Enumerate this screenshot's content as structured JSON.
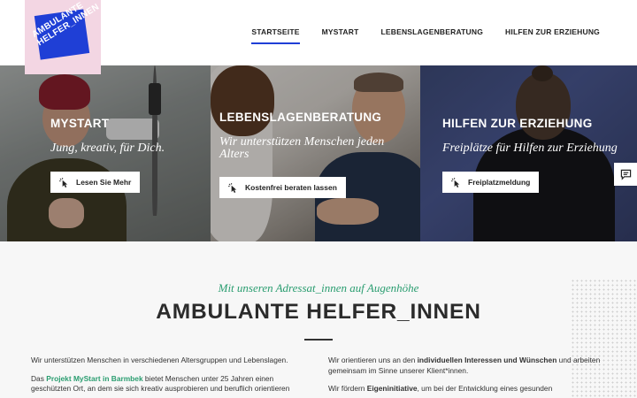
{
  "logo": {
    "line1": "AMBULANTE",
    "line2": "HELFER_INNEN"
  },
  "nav": {
    "items": [
      {
        "label": "STARTSEITE",
        "active": true
      },
      {
        "label": "MYSTART",
        "active": false
      },
      {
        "label": "LEBENSLAGENBERATUNG",
        "active": false
      },
      {
        "label": "HILFEN ZUR ERZIEHUNG",
        "active": false
      }
    ]
  },
  "hero": {
    "panels": [
      {
        "title": "MYSTART",
        "subtitle": "Jung, kreativ, für Dich.",
        "button": "Lesen Sie Mehr"
      },
      {
        "title": "LEBENSLAGENBERATUNG",
        "subtitle": "Wir unterstützen Menschen jeden Alters",
        "button": "Kostenfrei beraten lassen"
      },
      {
        "title": "HILFEN ZUR ERZIEHUNG",
        "subtitle": "Freiplätze für Hilfen zur Erziehung",
        "button": "Freiplatzmeldung"
      }
    ],
    "side_tab_icon": "chat-icon"
  },
  "main": {
    "tagline": "Mit unseren Adressat_innen auf Augenhöhe",
    "heading": "AMBULANTE HELFER_INNEN",
    "left": {
      "p1": "Wir unterstützen Menschen in verschiedenen Altersgruppen und Lebenslagen.",
      "p2_prefix": "Das ",
      "p2_link": "Projekt MyStart in Barmbek",
      "p2_rest": " bietet Menschen unter 25 Jahren einen geschützten Ort, an dem sie sich kreativ ausprobieren und beruflich orientieren"
    },
    "right": {
      "p1_prefix": "Wir orientieren uns an den ",
      "p1_strong": "individuellen Interessen und Wünschen",
      "p1_rest": " und arbeiten gemeinsam im Sinne unserer Klient*innen.",
      "p2_prefix": "Wir fördern ",
      "p2_strong": "Eigeninitiative",
      "p2_rest": ", um bei der Entwicklung eines gesunden"
    }
  },
  "colors": {
    "accent_blue": "#1f3fd6",
    "accent_green": "#2a9d70",
    "logo_bg": "#f3d6e3"
  }
}
